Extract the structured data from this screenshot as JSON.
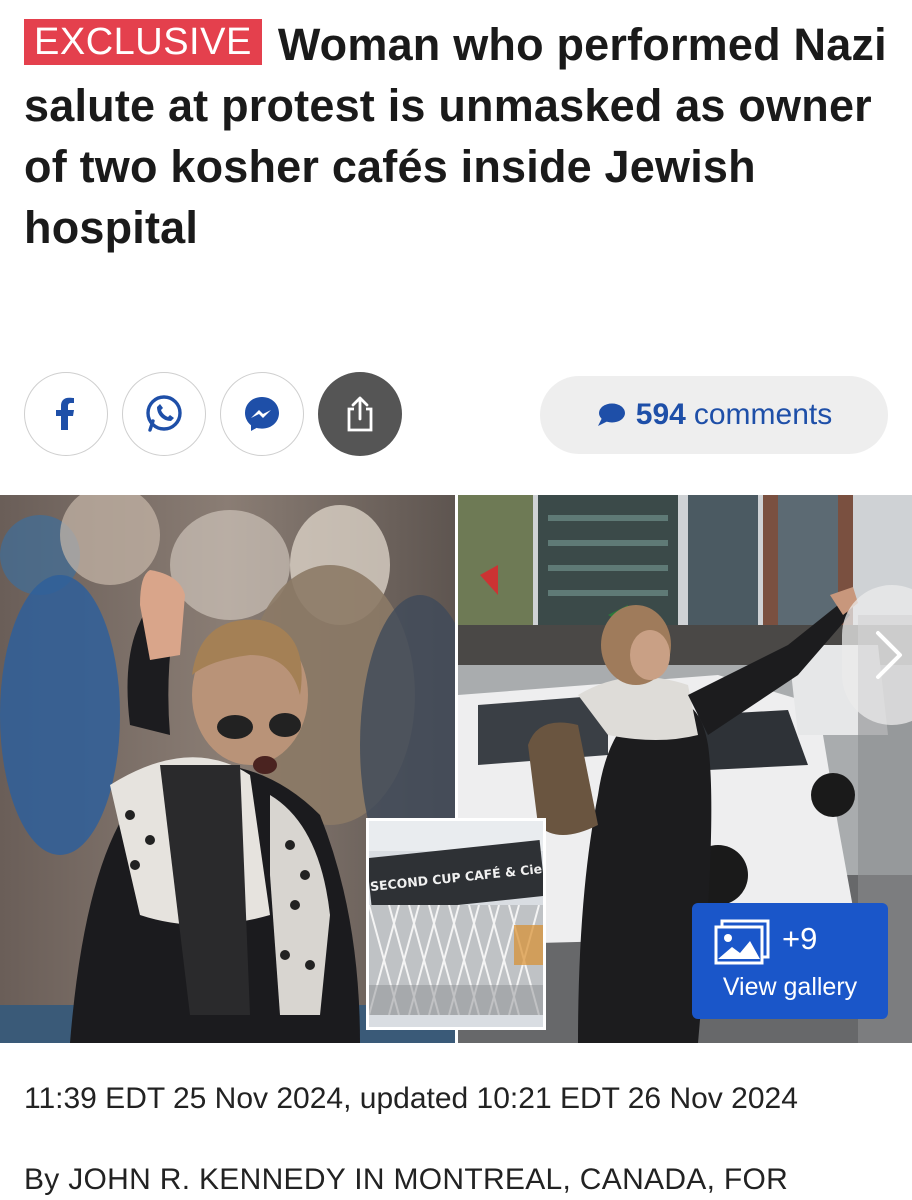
{
  "article": {
    "badge": "EXCLUSIVE",
    "headline": "Woman who performed Nazi salute at protest is unmasked as owner of two kosher cafés inside Jewish hospital",
    "timestamp": "11:39 EDT 25 Nov 2024, updated 10:21 EDT 26 Nov 2024",
    "byline": "By JOHN R. KENNEDY IN MONTREAL, CANADA, FOR"
  },
  "share": {
    "buttons": [
      {
        "icon": "facebook-icon"
      },
      {
        "icon": "whatsapp-icon"
      },
      {
        "icon": "messenger-icon"
      },
      {
        "icon": "share-icon"
      }
    ],
    "comments_count": "594",
    "comments_label": "comments"
  },
  "gallery": {
    "inset_sign": "SECOND CUP CAFÉ & Cie",
    "extra_count": "+9",
    "label": "View gallery"
  },
  "colors": {
    "badge": "#e4404d",
    "link": "#1e4fa8",
    "gallery_button": "#1a56c9"
  }
}
